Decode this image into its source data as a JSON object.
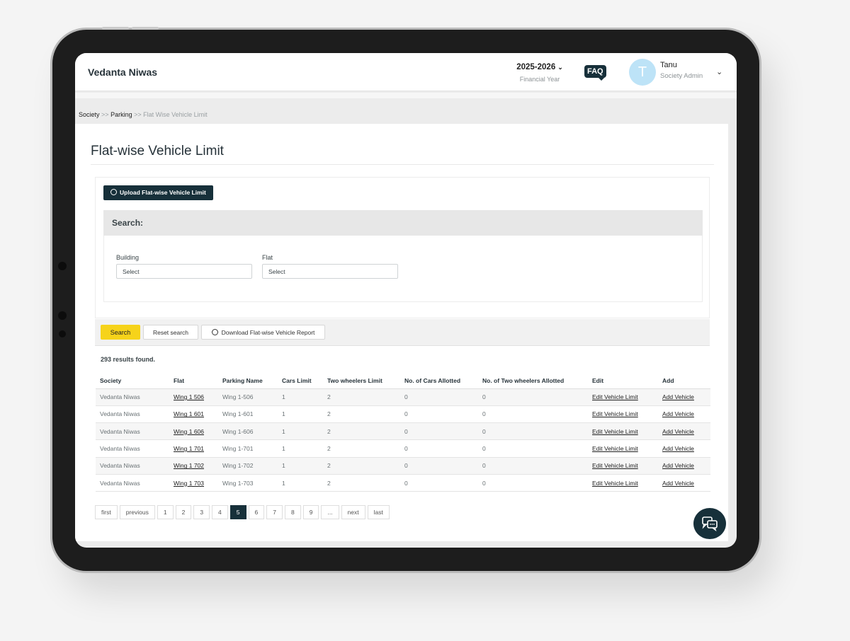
{
  "app": {
    "title": "Vedanta Niwas"
  },
  "header": {
    "year": "2025-2026",
    "year_label": "Financial Year",
    "faq": "FAQ",
    "avatar_letter": "T",
    "user_name": "Tanu",
    "user_role": "Society Admin"
  },
  "breadcrumb": {
    "items": [
      "Society",
      "Parking",
      "Flat Wise Vehicle Limit"
    ],
    "sep": ">>"
  },
  "page": {
    "title": "Flat-wise Vehicle Limit"
  },
  "upload": {
    "label": "Upload Flat-wise Vehicle Limit"
  },
  "search": {
    "heading": "Search:",
    "building_label": "Building",
    "building_value": "Select",
    "flat_label": "Flat",
    "flat_value": "Select",
    "search_btn": "Search",
    "reset_btn": "Reset search",
    "download_btn": "Download Flat-wise Vehicle Report"
  },
  "results": {
    "text": "293 results found."
  },
  "table": {
    "headers": [
      "Society",
      "Flat",
      "Parking Name",
      "Cars Limit",
      "Two wheelers Limit",
      "No. of Cars Allotted",
      "No. of Two wheelers Allotted",
      "Edit",
      "Add"
    ],
    "rows": [
      [
        "Vedanta Niwas",
        "Wing 1 506",
        "Wing 1-506",
        "1",
        "2",
        "0",
        "0",
        "Edit Vehicle Limit",
        "Add Vehicle"
      ],
      [
        "Vedanta Niwas",
        "Wing 1 601",
        "Wing 1-601",
        "1",
        "2",
        "0",
        "0",
        "Edit Vehicle Limit",
        "Add Vehicle"
      ],
      [
        "Vedanta Niwas",
        "Wing 1 606",
        "Wing 1-606",
        "1",
        "2",
        "0",
        "0",
        "Edit Vehicle Limit",
        "Add Vehicle"
      ],
      [
        "Vedanta Niwas",
        "Wing 1 701",
        "Wing 1-701",
        "1",
        "2",
        "0",
        "0",
        "Edit Vehicle Limit",
        "Add Vehicle"
      ],
      [
        "Vedanta Niwas",
        "Wing 1 702",
        "Wing 1-702",
        "1",
        "2",
        "0",
        "0",
        "Edit Vehicle Limit",
        "Add Vehicle"
      ],
      [
        "Vedanta Niwas",
        "Wing 1 703",
        "Wing 1-703",
        "1",
        "2",
        "0",
        "0",
        "Edit Vehicle Limit",
        "Add Vehicle"
      ]
    ]
  },
  "pagination": {
    "items": [
      "first",
      "previous",
      "1",
      "2",
      "3",
      "4",
      "5",
      "6",
      "7",
      "8",
      "9",
      "...",
      "next",
      "last"
    ],
    "active": "5"
  },
  "icons": {
    "upload": "info-circle-icon",
    "download": "info-circle-icon",
    "chat": "chat-bubbles-icon",
    "chevron": "chevron-down-icon"
  },
  "colors": {
    "primary": "#17303a",
    "accent": "#f6d31a",
    "avatar": "#bde3f7"
  }
}
